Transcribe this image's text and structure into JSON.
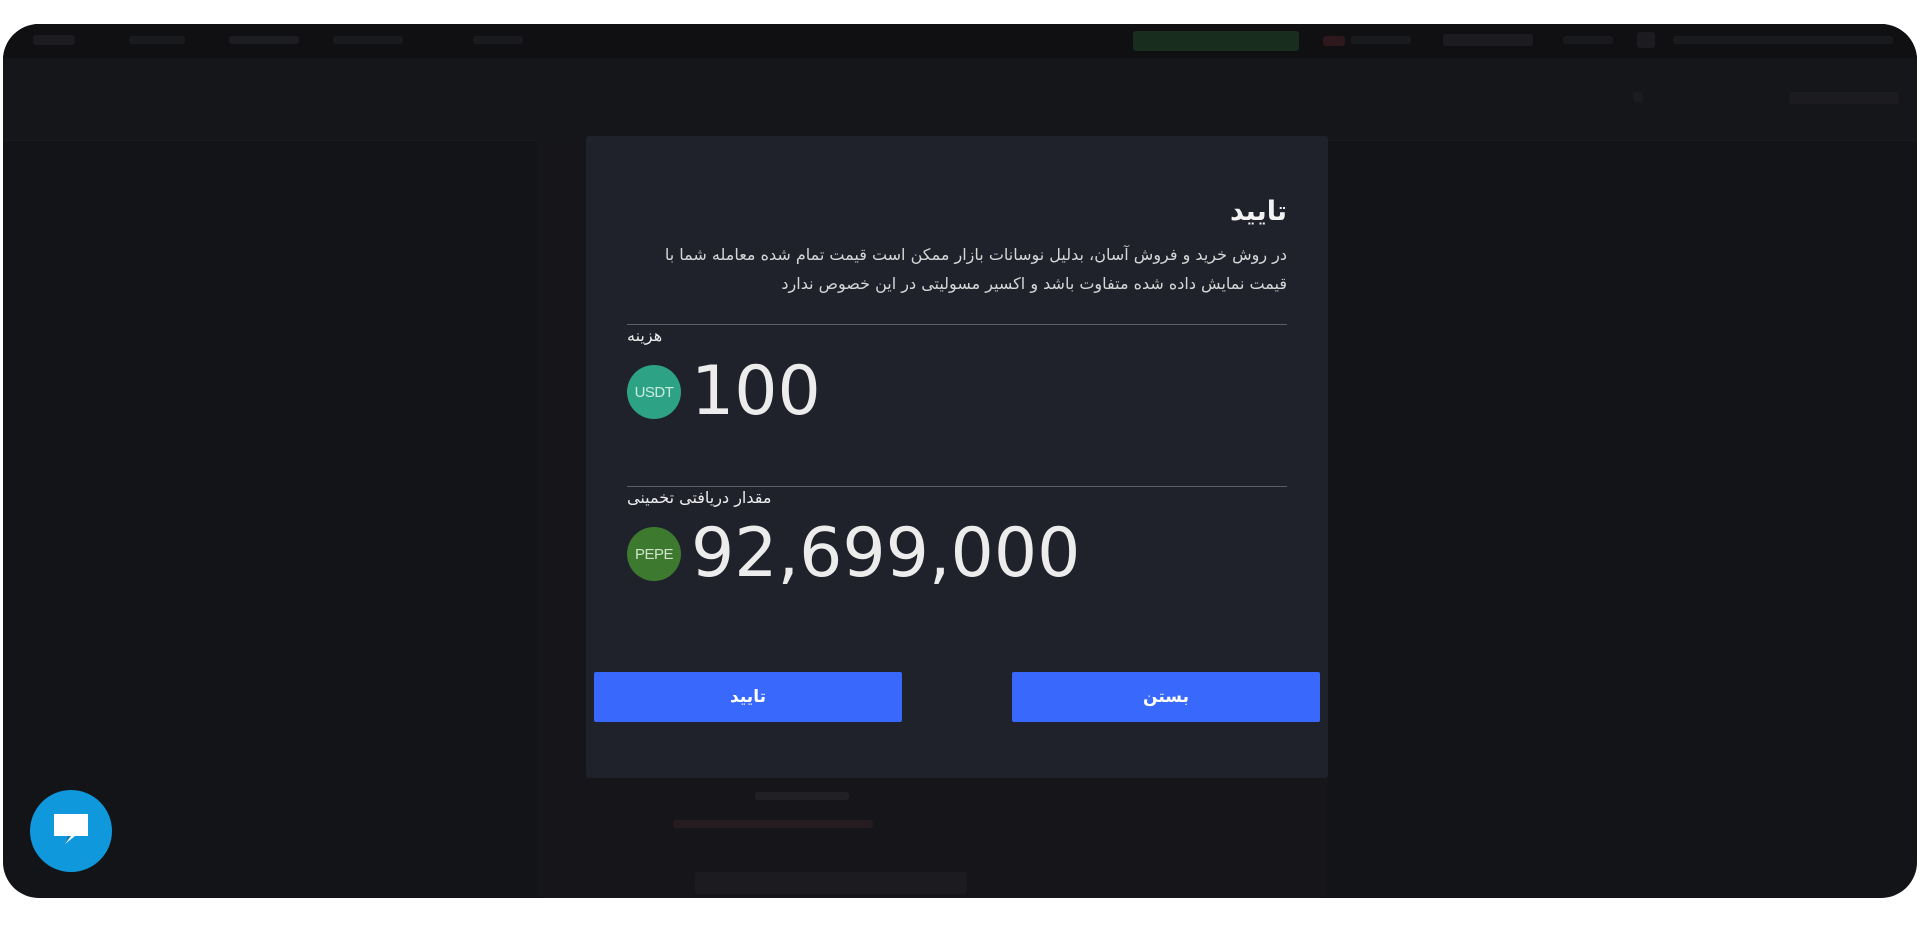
{
  "modal": {
    "title": "تایید",
    "description": "در روش خرید و فروش آسان، بدلیل نوسانات بازار ممکن است قیمت تمام شده معامله شما با قیمت نمایش داده شده متفاوت باشد و اکسیر مسولیتی در این خصوص ندارد",
    "cost": {
      "label": "هزینه",
      "amount": "100",
      "coin": "USDT",
      "coin_color": "#2ea285"
    },
    "estimated_receive": {
      "label": "مقدار دریافتی تخمینی",
      "amount": "92,699,000",
      "coin": "PEPE",
      "coin_color": "#3d7a30"
    },
    "buttons": {
      "close": "بستن",
      "confirm": "تایید"
    }
  },
  "colors": {
    "accent": "#3869fc",
    "chat": "#1098dc",
    "modal_bg": "#1f222b"
  },
  "chat_widget": {
    "icon": "chat-bubble-icon"
  }
}
